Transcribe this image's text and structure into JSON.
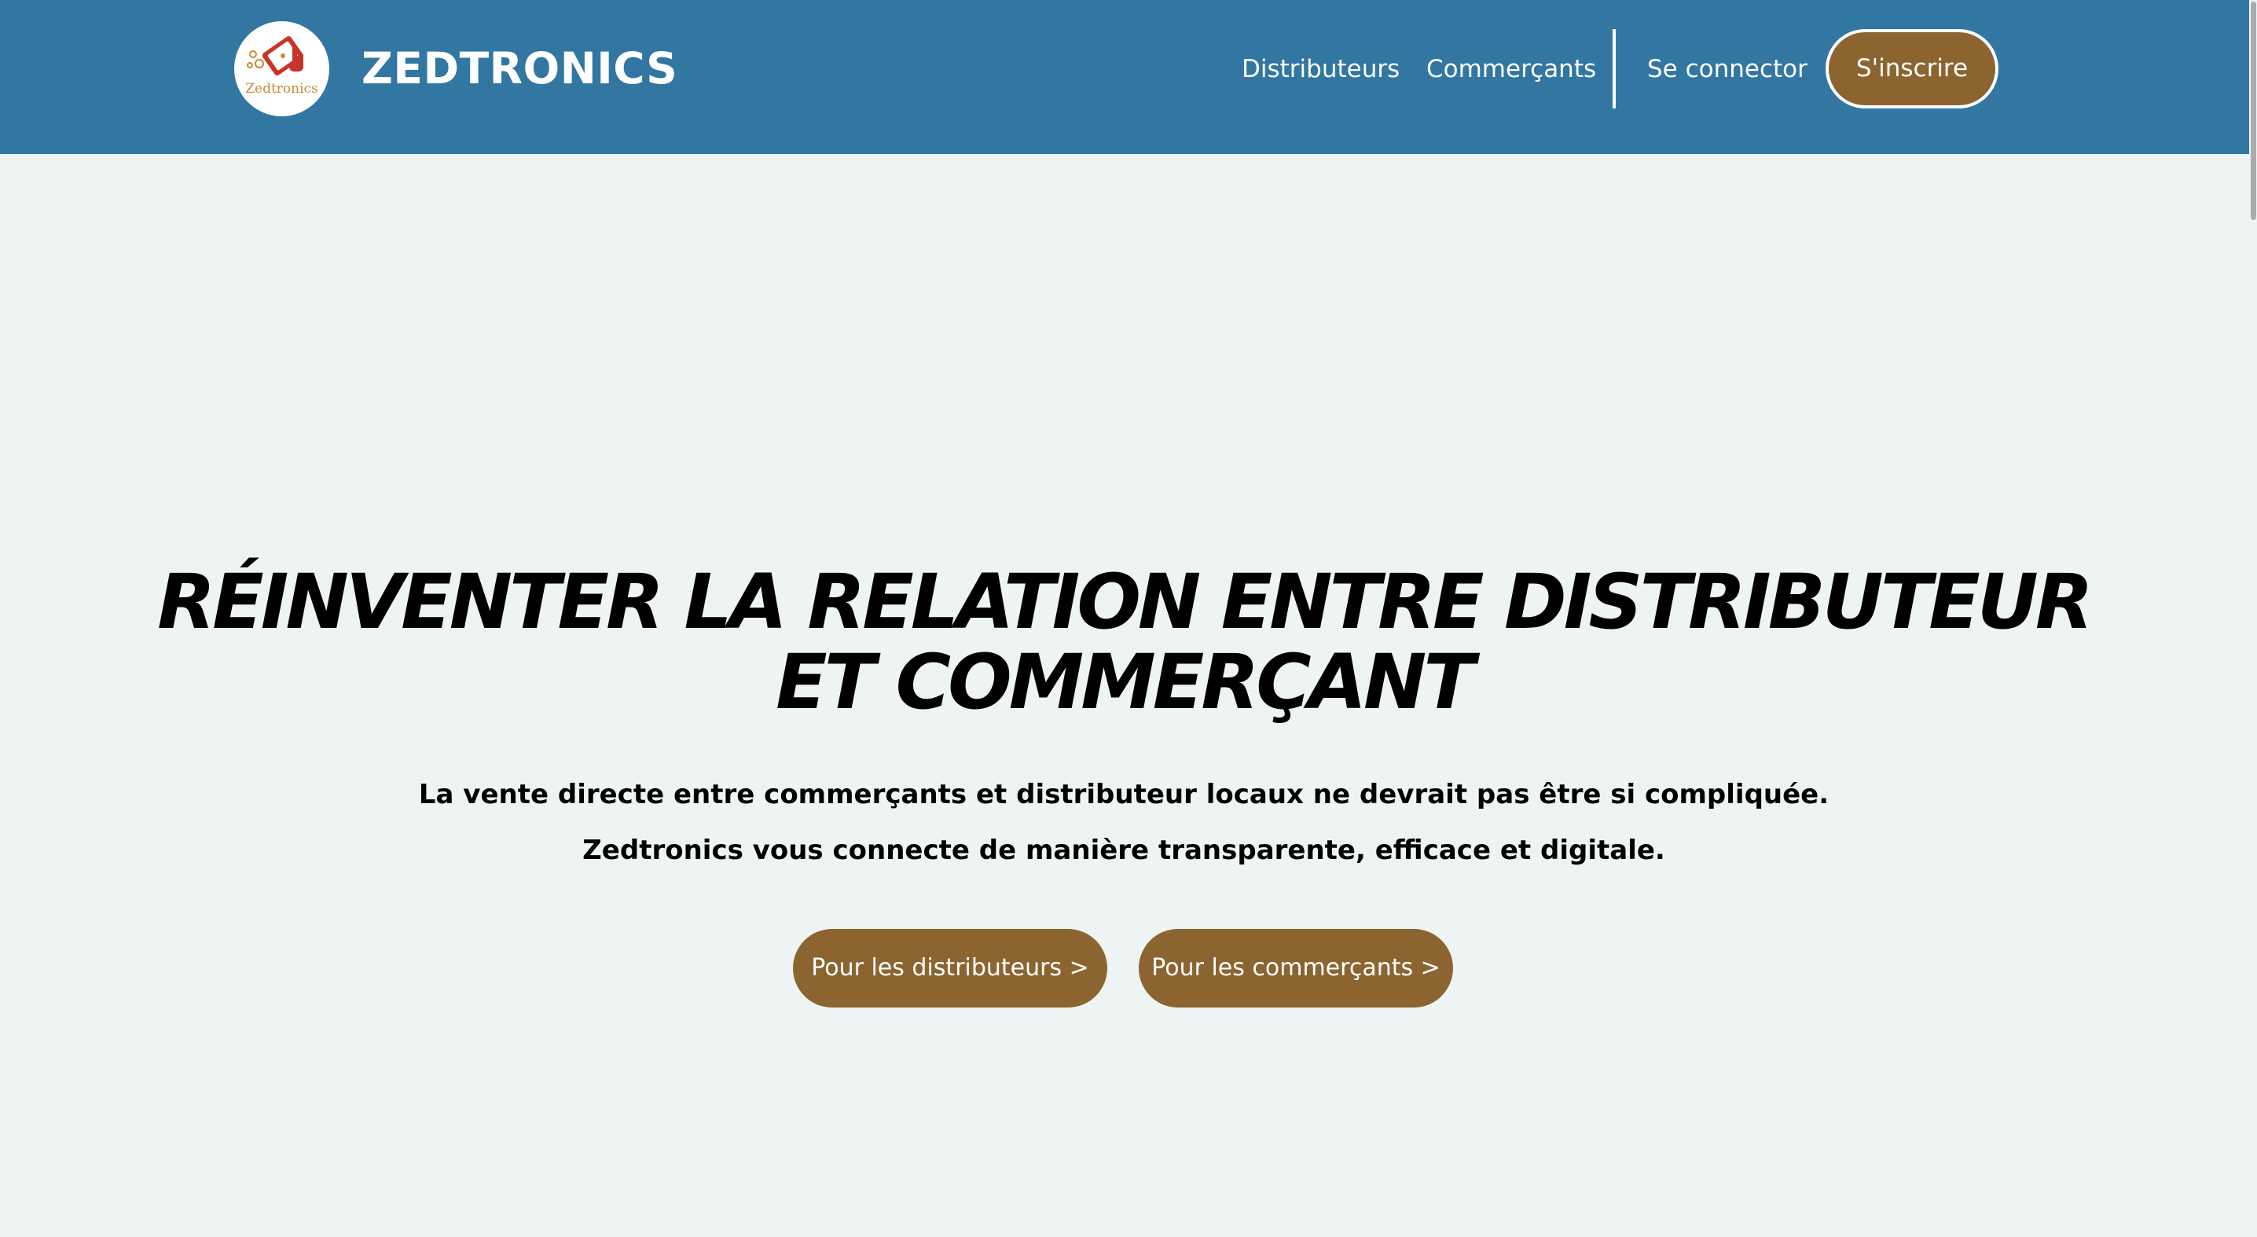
{
  "header": {
    "logo_text": "Zedtronics",
    "brand": "ZEDTRONICS",
    "nav": {
      "distributeurs": "Distributeurs",
      "commercants": "Commerçants",
      "login": "Se connector",
      "signup": "S'inscrire"
    }
  },
  "hero": {
    "title": "RÉINVENTER LA RELATION ENTRE DISTRIBUTEUR ET COMMERÇANT",
    "subtitle_line1": "La vente directe entre commerçants et distributeur locaux ne devrait pas être si compliquée.",
    "subtitle_line2": "Zedtronics vous connecte de manière transparente, efficace et digitale.",
    "cta_distributeurs": "Pour les distributeurs >",
    "cta_commercants": "Pour les commerçants >"
  },
  "colors": {
    "header_bg": "#3276a2",
    "page_bg": "#eef4f3",
    "accent": "#8b6430",
    "logo_red": "#c8342c",
    "logo_gold": "#c98b35"
  }
}
